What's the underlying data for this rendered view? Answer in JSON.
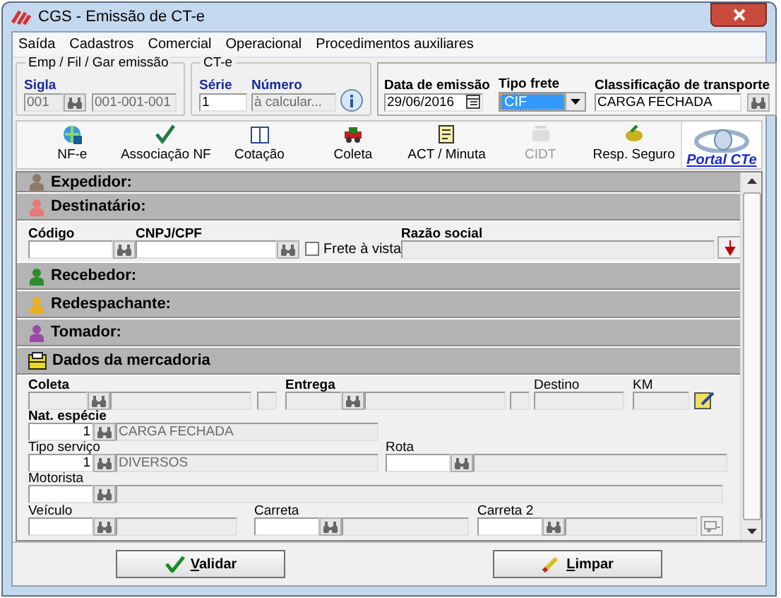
{
  "window": {
    "title": "CGS - Emissão de CT-e"
  },
  "menu": [
    "Saída",
    "Cadastros",
    "Comercial",
    "Operacional",
    "Procedimentos auxiliares"
  ],
  "emissor": {
    "legend": "Emp / Fil / Gar emissão",
    "sigla_label": "Sigla",
    "sigla": "001",
    "codigo": "001-001-001"
  },
  "cte": {
    "legend": "CT-e",
    "serie_label": "Série",
    "serie": "1",
    "numero_label": "Número",
    "numero": "à calcular..."
  },
  "emissao": {
    "data_label": "Data de emissão",
    "data": "29/06/2016",
    "tipo_frete_label": "Tipo frete",
    "tipo_frete": "CIF",
    "classificacao_label": "Classificação de transporte",
    "classificacao": "CARGA FECHADA"
  },
  "toolbar": [
    {
      "label": "NF-e",
      "disabled": false
    },
    {
      "label": "Associação NF",
      "disabled": false
    },
    {
      "label": "Cotação",
      "disabled": false
    },
    {
      "label": "Coleta",
      "disabled": false
    },
    {
      "label": "ACT / Minuta",
      "disabled": false
    },
    {
      "label": "CIDT",
      "disabled": true
    },
    {
      "label": "Resp. Seguro",
      "disabled": false
    }
  ],
  "portal_link": "Portal CTe",
  "sections": [
    {
      "title": "Expedidor:",
      "kind": "party",
      "color": "#8c7b6b"
    },
    {
      "title": "Destinatário:",
      "kind": "party",
      "color": "#e87878",
      "rows": [
        [
          {
            "kind": "input",
            "label": "Código",
            "required": true,
            "disabled": false,
            "lookup": true
          },
          {
            "kind": "input",
            "label": "CNPJ/CPF",
            "required": true,
            "disabled": false,
            "lookup": true
          },
          {
            "kind": "checkbox",
            "label": "Frete à vista",
            "checked": false
          },
          {
            "kind": "input",
            "label": "Razão social",
            "required": true,
            "disabled": true,
            "lookup": false
          },
          {
            "kind": "down-button"
          }
        ]
      ]
    },
    {
      "title": "Recebedor:",
      "kind": "party",
      "color": "#2e8b2e"
    },
    {
      "title": "Redespachante:",
      "kind": "party",
      "color": "#e8b020"
    },
    {
      "title": "Tomador:",
      "kind": "party",
      "color": "#9a4aa8"
    },
    {
      "title": "Dados da mercadoria",
      "kind": "cargo",
      "color": "#e8d820",
      "rows": [
        [
          {
            "kind": "input",
            "label": "Coleta",
            "required": true,
            "disabled": true,
            "lookup": true
          },
          {
            "kind": "input",
            "disabled": true,
            "lookup": false
          },
          {
            "kind": "input",
            "disabled": true,
            "lookup": false
          },
          {
            "kind": "input",
            "label": "Entrega",
            "required": true,
            "disabled": true,
            "lookup": true
          },
          {
            "kind": "input",
            "disabled": true,
            "lookup": false
          },
          {
            "kind": "input",
            "disabled": true,
            "lookup": false
          },
          {
            "kind": "input",
            "label": "Destino",
            "required": false,
            "disabled": true,
            "lookup": false
          },
          {
            "kind": "input",
            "label": "KM",
            "required": false,
            "disabled": true,
            "lookup": false
          },
          {
            "kind": "edit-button"
          }
        ],
        [
          {
            "kind": "input",
            "label": "Nat. espécie",
            "required": true,
            "disabled": false,
            "lookup": true,
            "value": "1"
          },
          {
            "kind": "input",
            "disabled": true,
            "lookup": false,
            "value": "CARGA FECHADA"
          }
        ],
        [
          {
            "kind": "input",
            "label": "Tipo serviço",
            "required": false,
            "disabled": false,
            "lookup": true,
            "value": "1"
          },
          {
            "kind": "input",
            "disabled": true,
            "lookup": false,
            "value": "DIVERSOS"
          },
          {
            "kind": "input",
            "label": "Rota",
            "required": false,
            "disabled": false,
            "lookup": true
          },
          {
            "kind": "input",
            "disabled": true,
            "lookup": false
          }
        ],
        [
          {
            "kind": "input",
            "label": "Motorista",
            "required": false,
            "disabled": false,
            "lookup": true
          },
          {
            "kind": "input",
            "disabled": true,
            "lookup": false
          }
        ],
        [
          {
            "kind": "input",
            "label": "Veículo",
            "required": false,
            "disabled": false,
            "lookup": true
          },
          {
            "kind": "input",
            "disabled": true,
            "lookup": false
          },
          {
            "kind": "input",
            "label": "Carreta",
            "required": false,
            "disabled": false,
            "lookup": true
          },
          {
            "kind": "input",
            "disabled": true,
            "lookup": false
          },
          {
            "kind": "input",
            "label": "Carreta 2",
            "required": false,
            "disabled": false,
            "lookup": true
          },
          {
            "kind": "input",
            "disabled": true,
            "lookup": false
          },
          {
            "kind": "trailer-button"
          }
        ]
      ]
    }
  ],
  "buttons": [
    {
      "label": "Validar",
      "kind": "validate"
    },
    {
      "label": "Limpar",
      "kind": "clear"
    }
  ]
}
